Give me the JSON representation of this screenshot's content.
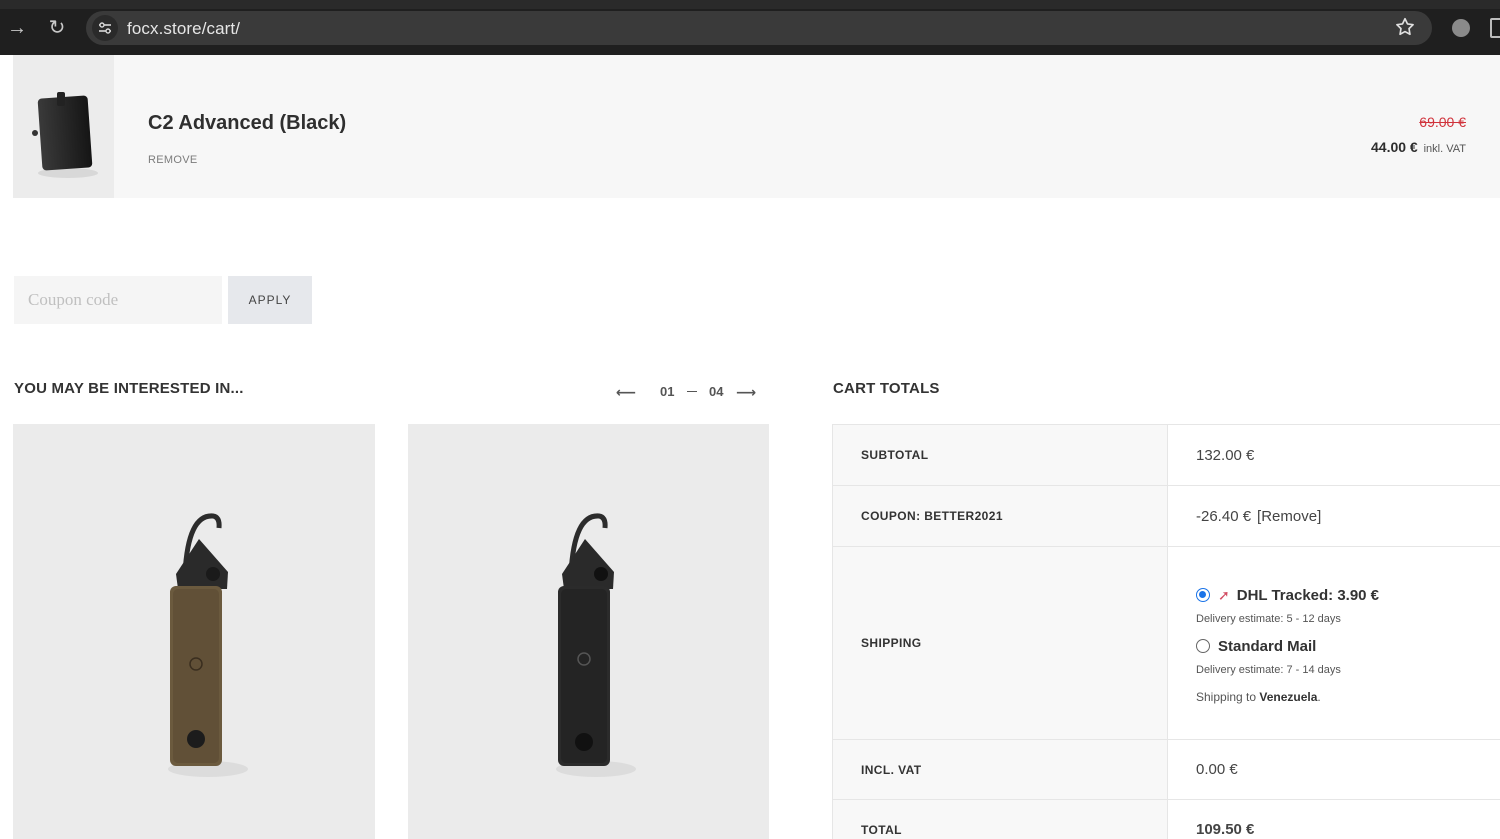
{
  "browser": {
    "url": "focx.store/cart/"
  },
  "cart_item": {
    "title": "C2 Advanced (Black)",
    "remove_label": "REMOVE",
    "old_price": "69.00 €",
    "price": "44.00 €",
    "price_suffix": "inkl. VAT"
  },
  "coupon": {
    "placeholder": "Coupon code",
    "apply_label": "APPLY"
  },
  "interested": {
    "title": "YOU MAY BE INTERESTED IN...",
    "pager_start": "01",
    "pager_end": "04"
  },
  "totals": {
    "title": "CART TOTALS",
    "subtotal_label": "SUBTOTAL",
    "subtotal_value": "132.00 €",
    "coupon_label": "COUPON: BETTER2021",
    "coupon_value": "-26.40 €",
    "coupon_remove": "[Remove]",
    "shipping_label": "SHIPPING",
    "shipping_options": [
      {
        "name": "DHL Tracked: 3.90 €",
        "estimate": "Delivery estimate: 5 - 12 days",
        "selected": true
      },
      {
        "name": "Standard Mail",
        "estimate": "Delivery estimate: 7 - 14 days",
        "selected": false
      }
    ],
    "shipping_to_prefix": "Shipping to",
    "shipping_to_country": "Venezuela",
    "vat_label": "INCL. VAT",
    "vat_value": "0.00 €",
    "total_label": "TOTAL",
    "total_value": "109.50 €"
  },
  "colors": {
    "strike_price": "#d0323b",
    "radio_selected": "#1a73e8"
  }
}
